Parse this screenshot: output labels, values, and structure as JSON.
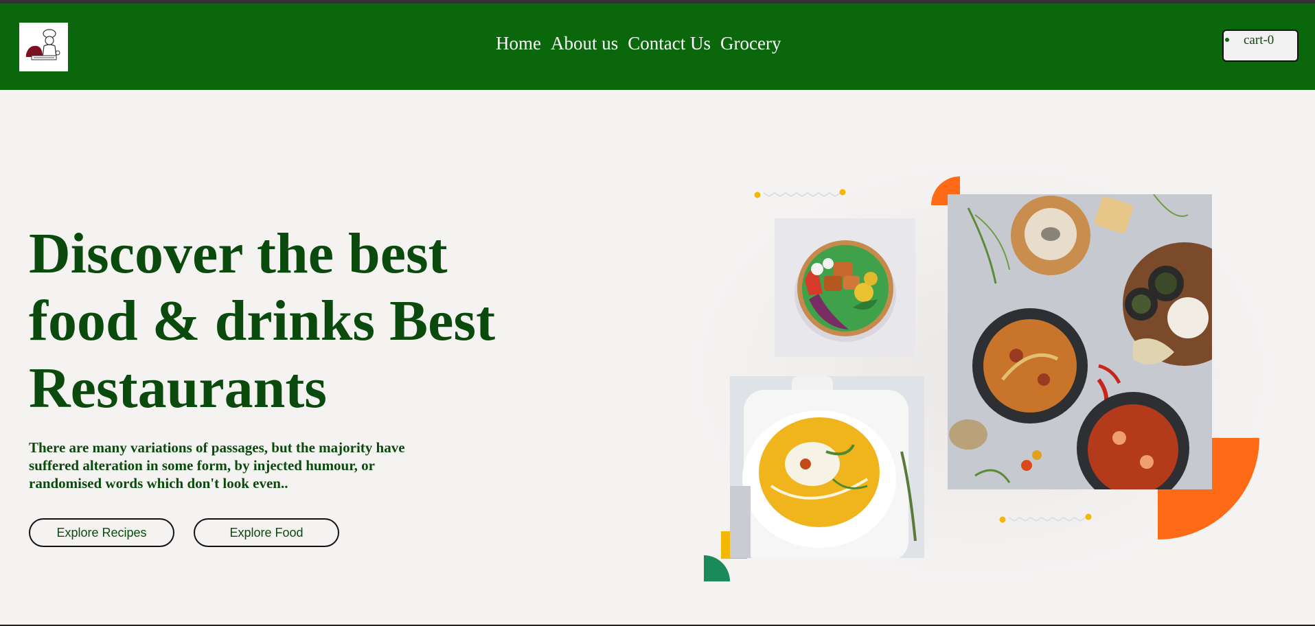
{
  "nav": {
    "links": [
      "Home",
      "About us",
      "Contact Us",
      "Grocery"
    ],
    "cart_label": "cart-0"
  },
  "hero": {
    "title": "Discover the best food & drinks Best Restaurants",
    "description": "There are many variations of passages, but the majority have suffered alteration in some form, by injected humour, or randomised words which don't look even..",
    "buttons": {
      "explore_recipes": "Explore Recipes",
      "explore_food": "Explore Food"
    }
  },
  "colors": {
    "nav_bg": "#0b670c",
    "hero_bg": "#f5f3f2",
    "heading": "#0a4a0c",
    "accent_orange": "#ff6a17",
    "accent_yellow": "#f5b800",
    "accent_green": "#1a8a5a"
  },
  "icons": [
    "chef-logo-icon",
    "cart-dot-icon"
  ]
}
